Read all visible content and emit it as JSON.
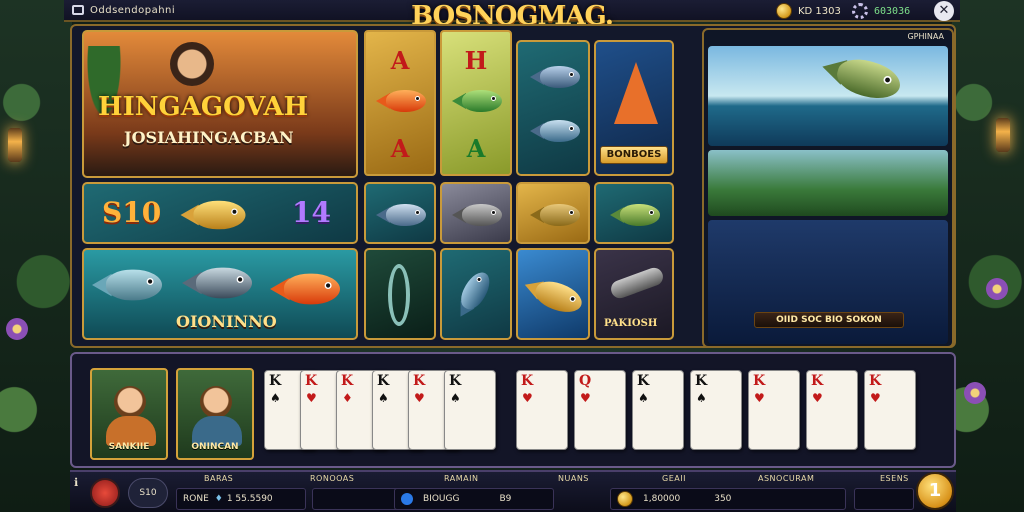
{
  "header": {
    "left_label": "Oddsendopahni",
    "title": "BOSNOGMAG.",
    "coins_value": "KD 1303",
    "green_value": "603036"
  },
  "tiles": {
    "hero_title": "HINGAGOVAH",
    "hero_subtitle": "JOSIAHINGACBAN",
    "score_left": "S10",
    "score_right": "14",
    "bottom_banner": "OIONINNO",
    "letters_a": [
      "A",
      "A"
    ],
    "letters_b": [
      "H",
      "A"
    ],
    "bonus_label": "BONBOES",
    "cannon_label": "PAKIOSH",
    "right_panel_tag": "GPHINAA",
    "right_panel_btn": "",
    "cards_panel_label": "OIID SOC BIO SOKON"
  },
  "portraits": [
    {
      "label": "SANKIIE"
    },
    {
      "label": "ONINCAN"
    }
  ],
  "cards_left": [
    {
      "rank": "K",
      "suit": "♠",
      "color": "#111"
    },
    {
      "rank": "K",
      "suit": "♥",
      "color": "#c21a1a"
    },
    {
      "rank": "K",
      "suit": "♦",
      "color": "#c21a1a"
    },
    {
      "rank": "K",
      "suit": "♠",
      "color": "#111"
    },
    {
      "rank": "K",
      "suit": "♥",
      "color": "#c21a1a"
    },
    {
      "rank": "K",
      "suit": "♠",
      "color": "#111"
    }
  ],
  "cards_right": [
    {
      "rank": "K",
      "suit": "♥",
      "color": "#c21a1a"
    },
    {
      "rank": "Q",
      "suit": "♥",
      "color": "#c21a1a"
    },
    {
      "rank": "K",
      "suit": "♠",
      "color": "#111"
    },
    {
      "rank": "K",
      "suit": "♠",
      "color": "#111"
    },
    {
      "rank": "K",
      "suit": "♥",
      "color": "#c21a1a"
    },
    {
      "rank": "K",
      "suit": "♥",
      "color": "#c21a1a"
    },
    {
      "rank": "K",
      "suit": "♥",
      "color": "#c21a1a"
    }
  ],
  "stats": {
    "headers": [
      "BARAS",
      "RONOOAS",
      "RAMAIN",
      "NUANS",
      "GEAII",
      "ASNOCURAM",
      "ESENS"
    ],
    "bet_label": "RONE",
    "bet_value": "1 55.5590",
    "mode_value": "S10",
    "balance_label": "BIOUGG",
    "balance_value": "B9",
    "win_value": "1,80000",
    "win_extra": "350",
    "spin_label": "1"
  },
  "colors": {
    "gold": "#c99a3a",
    "accent": "#ffd25a"
  }
}
